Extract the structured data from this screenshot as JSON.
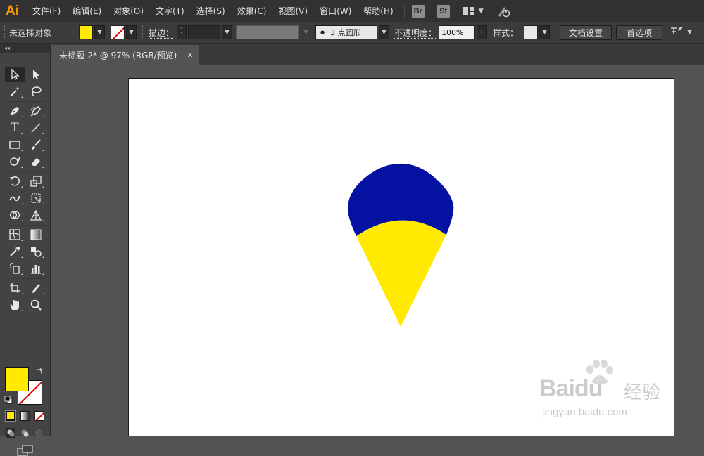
{
  "app": {
    "logo": "Ai"
  },
  "menu": {
    "items": [
      "文件(F)",
      "编辑(E)",
      "对象(O)",
      "文字(T)",
      "选择(S)",
      "效果(C)",
      "视图(V)",
      "窗口(W)",
      "帮助(H)"
    ],
    "bridge_badge": "Br",
    "stock_badge": "St"
  },
  "control": {
    "selection_label": "未选择对象",
    "stroke_label": "描边：",
    "brush_value": "3 点圆形",
    "opacity_label": "不透明度：",
    "opacity_value": "100%",
    "style_label": "样式：",
    "doc_setup_button": "文档设置",
    "prefs_button": "首选项"
  },
  "tab": {
    "title": "未标题-2* @ 97% (RGB/预览)",
    "close": "✕"
  },
  "colors": {
    "fill": "#ffea00",
    "artwork_top": "#0511a0",
    "artwork_bottom": "#ffea00",
    "accent": "#ff9a00"
  },
  "watermark": {
    "brand": "Bai",
    "brand_du": "du",
    "chinese": "经验",
    "url": "jingyan.baidu.com"
  }
}
